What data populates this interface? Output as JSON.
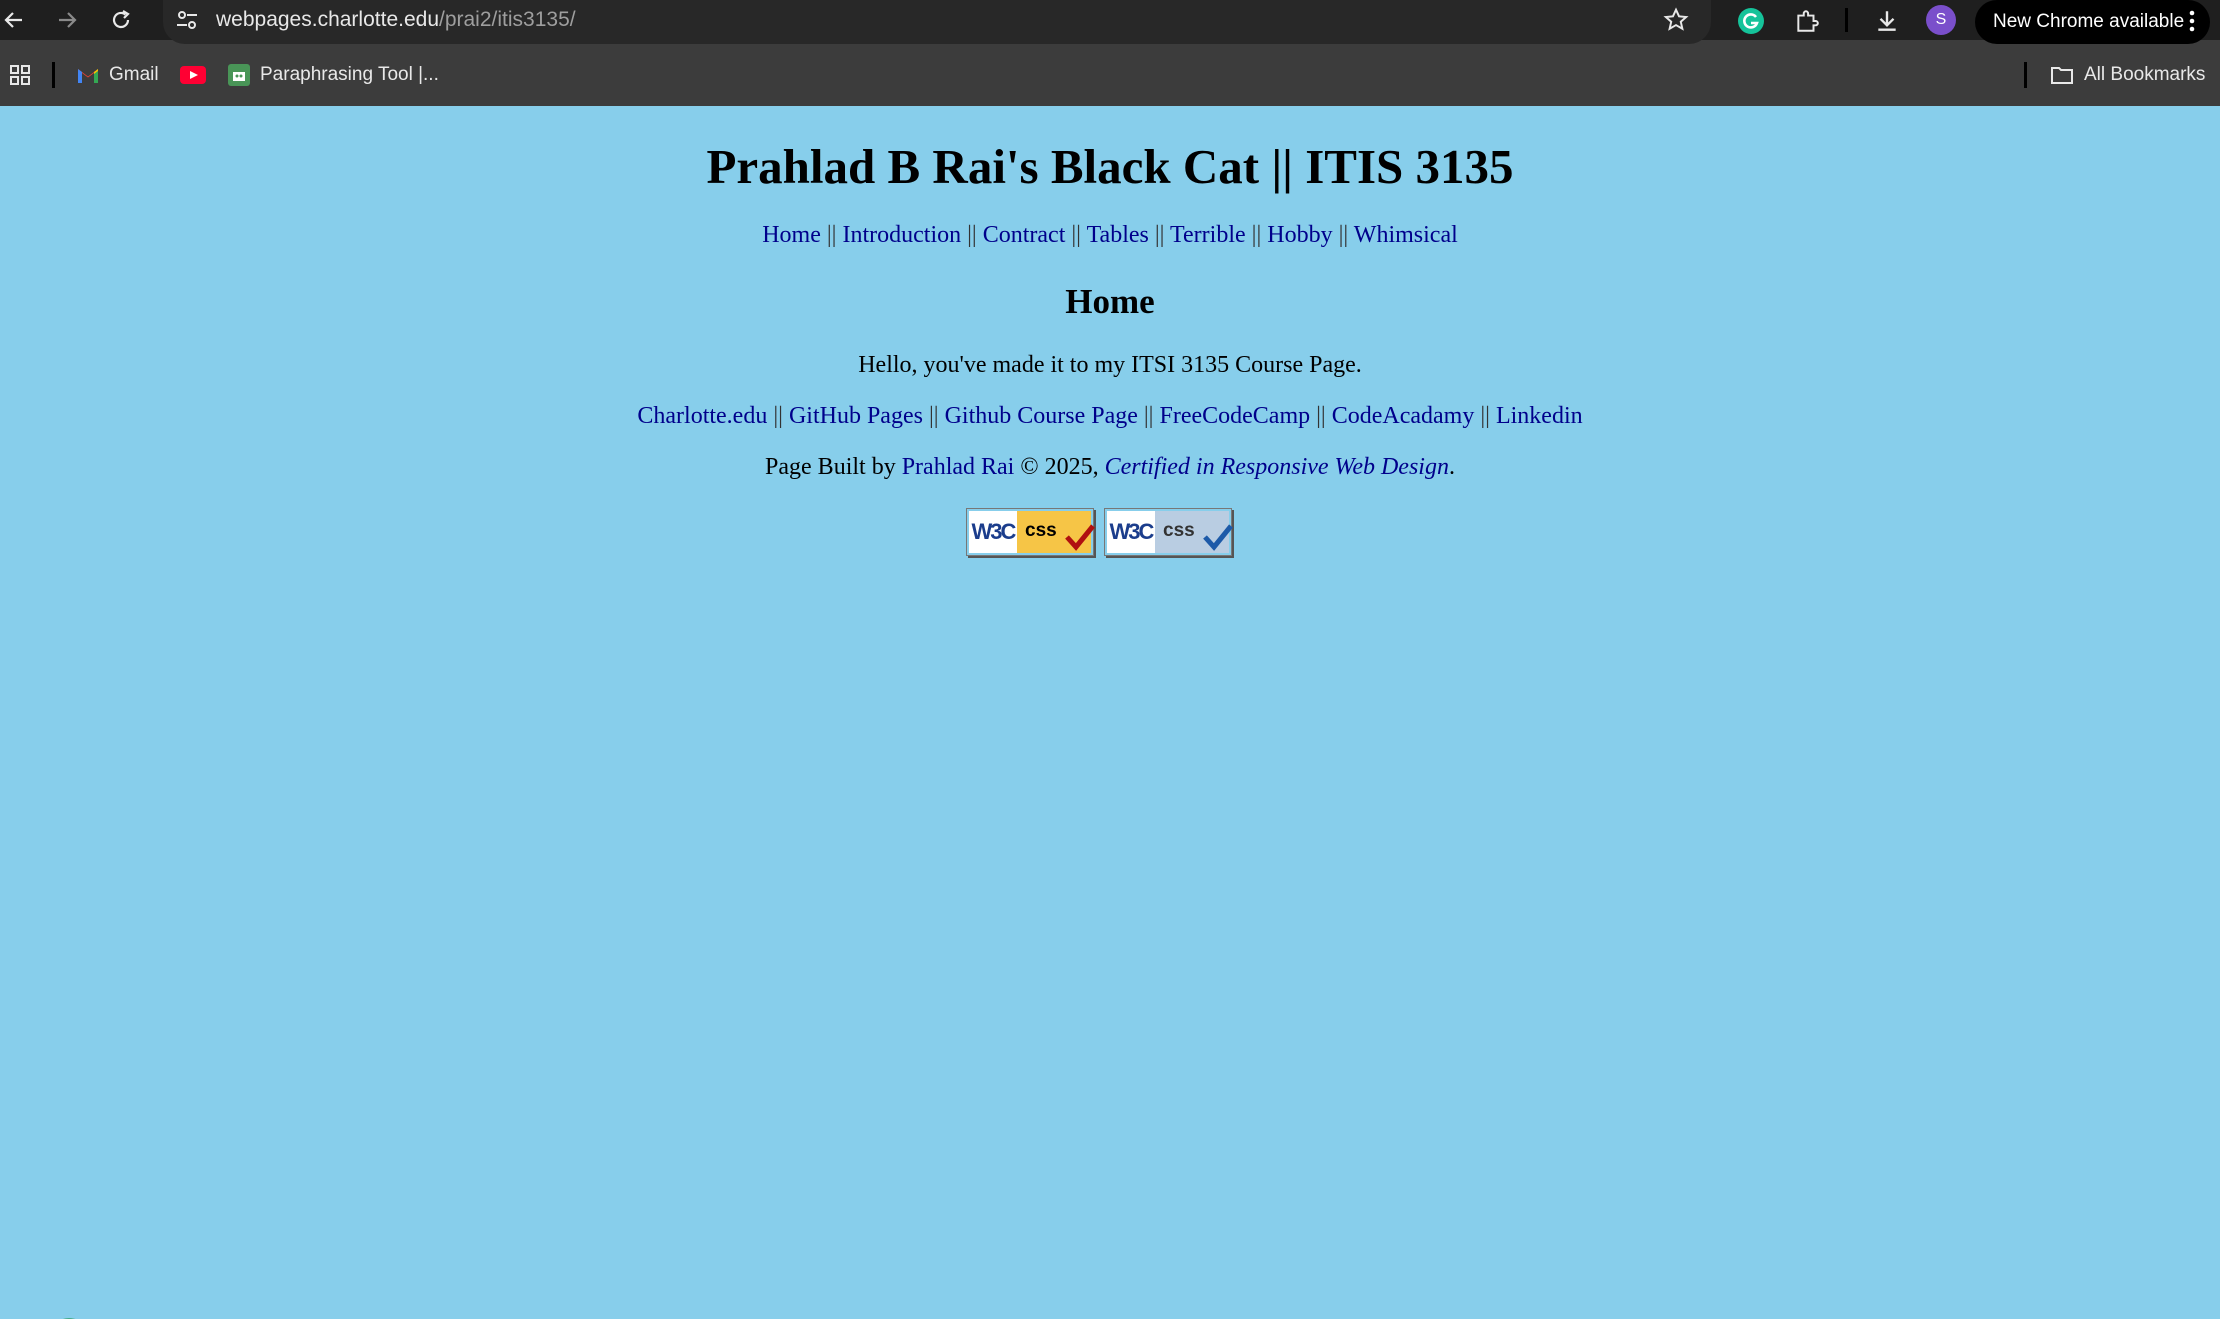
{
  "browser": {
    "url_domain": "webpages.charlotte.edu",
    "url_path": "/prai2/itis3135/",
    "avatar_letter": "S",
    "update_label": "New Chrome available",
    "bookmarks": {
      "gmail": "Gmail",
      "paraphrasing": "Paraphrasing Tool |...",
      "all_bookmarks": "All Bookmarks"
    }
  },
  "page": {
    "title": "Prahlad B Rai's Black Cat || ITIS 3135",
    "nav": [
      "Home",
      "Introduction",
      "Contract",
      "Tables",
      "Terrible",
      "Hobby",
      "Whimsical"
    ],
    "separator": "||",
    "heading": "Home",
    "intro": "Hello, you've made it to my ITSI 3135 Course Page.",
    "links": [
      "Charlotte.edu",
      "GitHub Pages",
      "Github Course Page",
      "FreeCodeCamp",
      "CodeAcadamy",
      "Linkedin"
    ],
    "footer": {
      "prefix": "Page Built by",
      "author": "Prahlad Rai",
      "copyright": "© 2025,",
      "certification": "Certified in Responsive Web Design",
      "period": "."
    },
    "badges": {
      "w3c_text": "W3C",
      "css_text": "css"
    }
  },
  "colors": {
    "page_background": "#87ceeb",
    "link": "#00008b",
    "chrome_dark": "#1f1f1f"
  }
}
